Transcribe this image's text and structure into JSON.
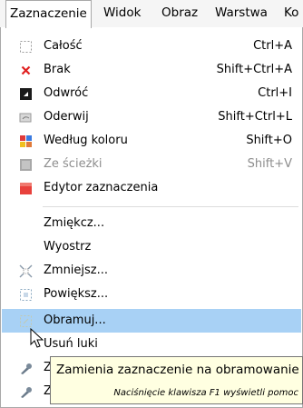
{
  "menubar": {
    "items": [
      {
        "label": "Zaznaczenie"
      },
      {
        "label": "Widok"
      },
      {
        "label": "Obraz"
      },
      {
        "label": "Warstwa"
      },
      {
        "label": "Ko"
      }
    ]
  },
  "menu": {
    "items": [
      {
        "icon": "select-all-icon",
        "label": "Całość",
        "shortcut": "Ctrl+A"
      },
      {
        "icon": "red-x-icon",
        "label": "Brak",
        "shortcut": "Shift+Ctrl+A"
      },
      {
        "icon": "invert-icon",
        "label": "Odwróć",
        "shortcut": "Ctrl+I"
      },
      {
        "icon": "float-icon",
        "label": "Oderwij",
        "shortcut": "Shift+Ctrl+L"
      },
      {
        "icon": "by-color-icon",
        "label": "Według koloru",
        "shortcut": "Shift+O"
      },
      {
        "icon": "from-path-icon",
        "label": "Ze ścieżki",
        "shortcut": "Shift+V",
        "disabled": true
      },
      {
        "icon": "selection-editor-icon",
        "label": "Edytor zaznaczenia",
        "shortcut": ""
      },
      {
        "icon": "",
        "label": "Zmiękcz...",
        "shortcut": ""
      },
      {
        "icon": "",
        "label": "Wyostrz",
        "shortcut": ""
      },
      {
        "icon": "shrink-icon",
        "label": "Zmniejsz...",
        "shortcut": ""
      },
      {
        "icon": "grow-icon",
        "label": "Powiększ...",
        "shortcut": ""
      },
      {
        "icon": "border-icon",
        "label": "Obramuj...",
        "shortcut": "",
        "highlighted": true
      },
      {
        "icon": "",
        "label": "Usuń luki",
        "shortcut": ""
      },
      {
        "icon": "brush-icon",
        "label": "Z",
        "shortcut": ""
      },
      {
        "icon": "brush-icon",
        "label": "Z...",
        "shortcut": ""
      }
    ]
  },
  "tooltip": {
    "text": "Zamienia zaznaczenie na obramowanie",
    "hint": "Naciśnięcie klawisza F1 wyświetli pomoc"
  },
  "colors": {
    "highlight": "#a8d1f5",
    "tooltip_bg": "#ffffe1",
    "red": "#e02020"
  }
}
